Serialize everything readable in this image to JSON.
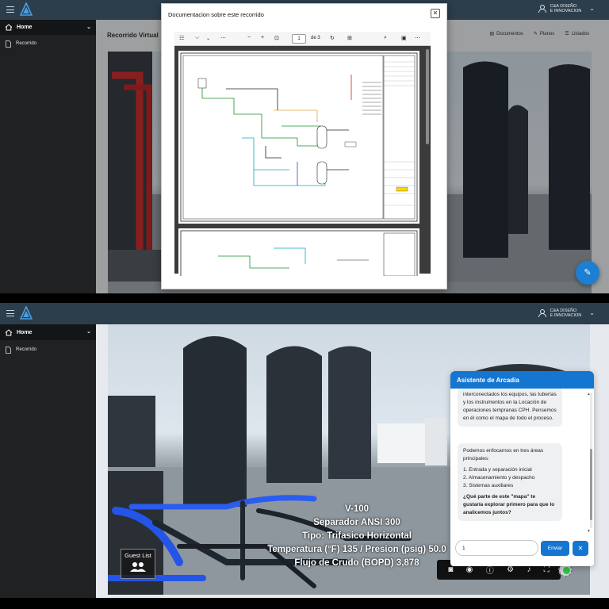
{
  "app": {
    "company_line1": "C&A DISEÑO",
    "company_line2": "E INNOVACION"
  },
  "sidebar": {
    "home_label": "Home",
    "recorrido_label": "Recorrido"
  },
  "top": {
    "content_title": "Recorrido Virtual",
    "tabs": [
      "Documentos",
      "Planos",
      "Listados"
    ],
    "modal": {
      "title": "Documentacion sobre este recorrido",
      "page_current": "1",
      "page_total": "de 3"
    }
  },
  "bottom": {
    "hud": {
      "line1": "V-100",
      "line2": "Separador ANSI 300",
      "line3": "Tipo: Trifasico Horizontal",
      "line4": "Temperatura (°F) 135 / Presion (psig) 50.0",
      "line5": "Flujo de Crudo (BOPD) 3,878"
    },
    "guest_list_label": "Guest List",
    "chat": {
      "title": "Asistente de Arcadia",
      "msg1": "interconectados los equipos, las tuberías y los instrumentos en la Locación de operaciones tempranas CPH. Pensemos en él como el mapa de todo el proceso.",
      "msg2_intro": "Podemos enfocarnos en tres áreas principales:",
      "msg2_items": [
        "1. Entrada y separación inicial",
        "2. Almacenamiento y despacho",
        "3. Sistemas auxiliares"
      ],
      "msg2_question": "¿Qué parte de este \"mapa\" te gustaría explorar primero para que lo analicemos juntos?",
      "input_value": "1",
      "send_label": "Enviar"
    }
  },
  "colors": {
    "accent": "#1576d1",
    "topbar": "#2c3e4c",
    "sidebar": "#1f2123"
  }
}
